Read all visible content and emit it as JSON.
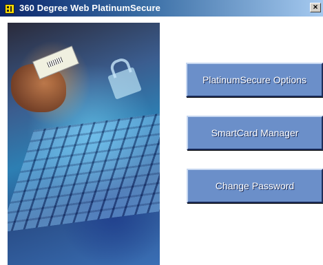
{
  "window": {
    "title": "360 Degree Web PlatinumSecure",
    "close_label": "×",
    "icon": "app-icon"
  },
  "buttons": [
    {
      "label": "PlatinumSecure Options"
    },
    {
      "label": "SmartCard Manager"
    },
    {
      "label": "Change Password"
    }
  ],
  "hero": {
    "description_icon": "security-photo"
  }
}
